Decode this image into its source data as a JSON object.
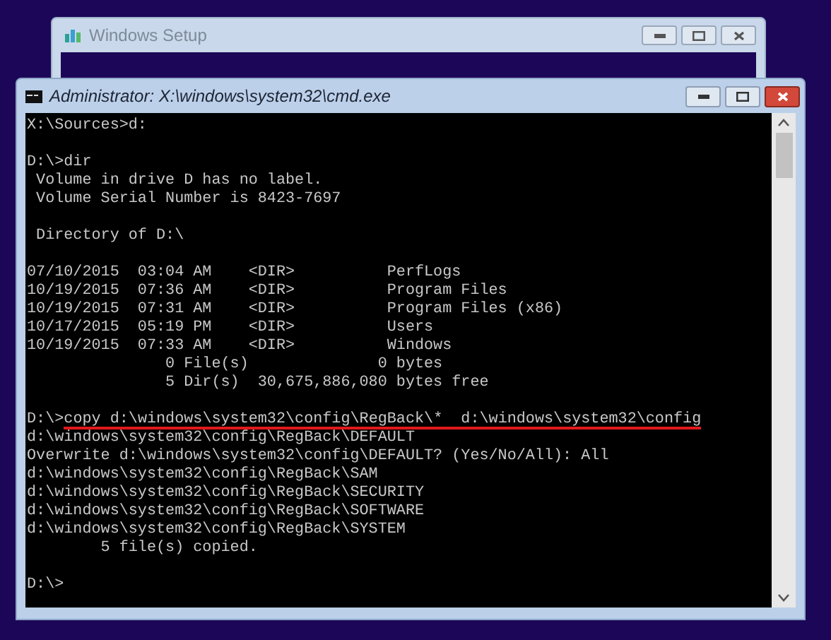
{
  "setup_window": {
    "title": "Windows Setup"
  },
  "cmd_window": {
    "title": "Administrator: X:\\windows\\system32\\cmd.exe",
    "blocks": [
      [
        {
          "text": "X:\\Sources>d:"
        }
      ],
      [
        {
          "text": "D:\\>dir"
        },
        {
          "text": " Volume in drive D has no label."
        },
        {
          "text": " Volume Serial Number is 8423-7697"
        }
      ],
      [
        {
          "text": " Directory of D:\\"
        }
      ],
      [
        {
          "text": "07/10/2015  03:04 AM    <DIR>          PerfLogs"
        },
        {
          "text": "10/19/2015  07:36 AM    <DIR>          Program Files"
        },
        {
          "text": "10/19/2015  07:31 AM    <DIR>          Program Files (x86)"
        },
        {
          "text": "10/17/2015  05:19 PM    <DIR>          Users"
        },
        {
          "text": "10/19/2015  07:33 AM    <DIR>          Windows"
        },
        {
          "text": "               0 File(s)              0 bytes"
        },
        {
          "text": "               5 Dir(s)  30,675,886,080 bytes free"
        }
      ],
      [
        {
          "prompt": "D:\\>",
          "text": "copy d:\\windows\\system32\\config\\RegBack\\*  d:\\windows\\system32\\config",
          "underlined": true
        },
        {
          "text": "d:\\windows\\system32\\config\\RegBack\\DEFAULT"
        },
        {
          "text": "Overwrite d:\\windows\\system32\\config\\DEFAULT? (Yes/No/All): All"
        },
        {
          "text": "d:\\windows\\system32\\config\\RegBack\\SAM"
        },
        {
          "text": "d:\\windows\\system32\\config\\RegBack\\SECURITY"
        },
        {
          "text": "d:\\windows\\system32\\config\\RegBack\\SOFTWARE"
        },
        {
          "text": "d:\\windows\\system32\\config\\RegBack\\SYSTEM"
        },
        {
          "text": "        5 file(s) copied."
        }
      ],
      [
        {
          "text": "D:\\>"
        }
      ]
    ]
  }
}
